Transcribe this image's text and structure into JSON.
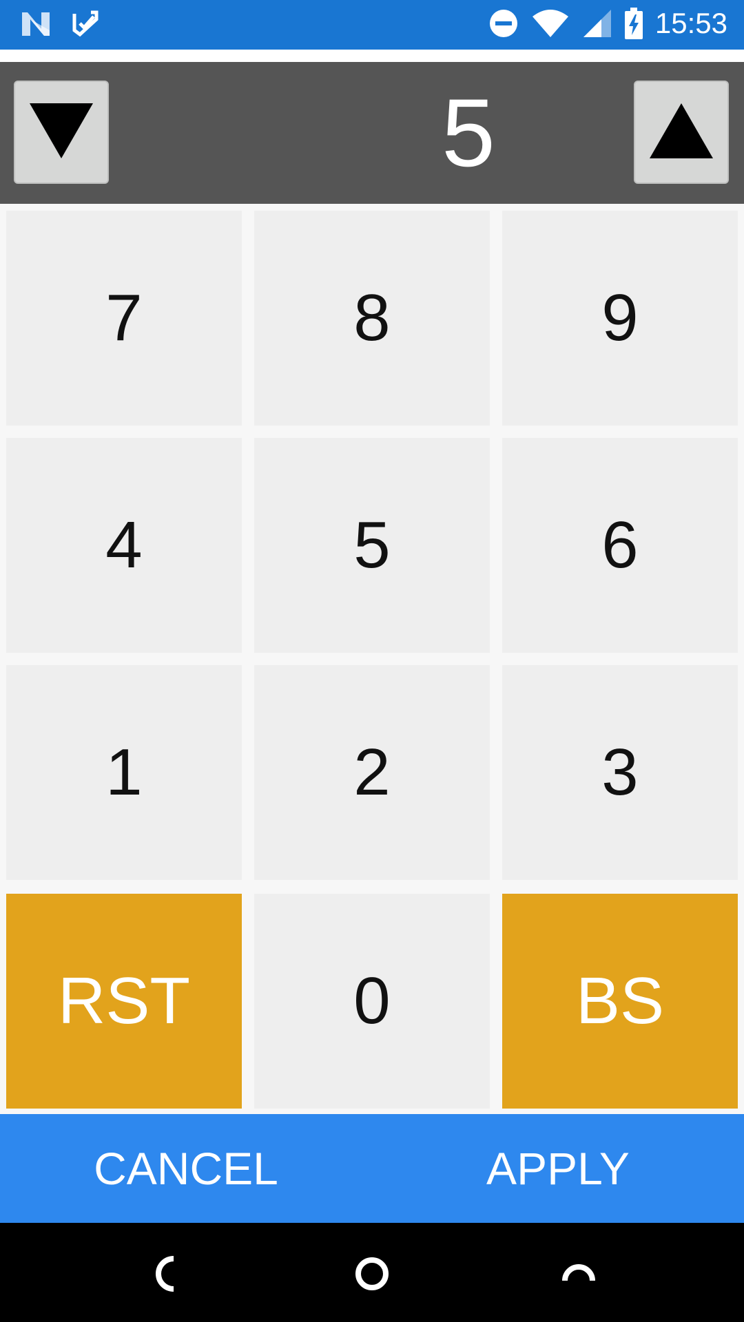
{
  "status_bar": {
    "time": "15:53",
    "bg_color": "#1976d2",
    "left_icons": [
      "n-notification-icon",
      "checklist-notification-icon"
    ],
    "right_icons": [
      "do-not-disturb-icon",
      "wifi-icon",
      "cell-signal-icon",
      "battery-charging-icon"
    ]
  },
  "stepper": {
    "value": "5",
    "decrement_icon": "triangle-down-icon",
    "increment_icon": "triangle-up-icon",
    "bg_color": "#555555"
  },
  "keypad": {
    "rows": [
      [
        "7",
        "8",
        "9"
      ],
      [
        "4",
        "5",
        "6"
      ],
      [
        "1",
        "2",
        "3"
      ],
      [
        "RST",
        "0",
        "BS"
      ]
    ],
    "accent_color": "#e2a31c",
    "key_color": "#eeeeee"
  },
  "actions": {
    "cancel_label": "CANCEL",
    "apply_label": "APPLY",
    "bg_color": "#2e88ee"
  },
  "nav_bar": {
    "icons": [
      "back-icon",
      "home-icon",
      "recent-apps-icon"
    ]
  }
}
